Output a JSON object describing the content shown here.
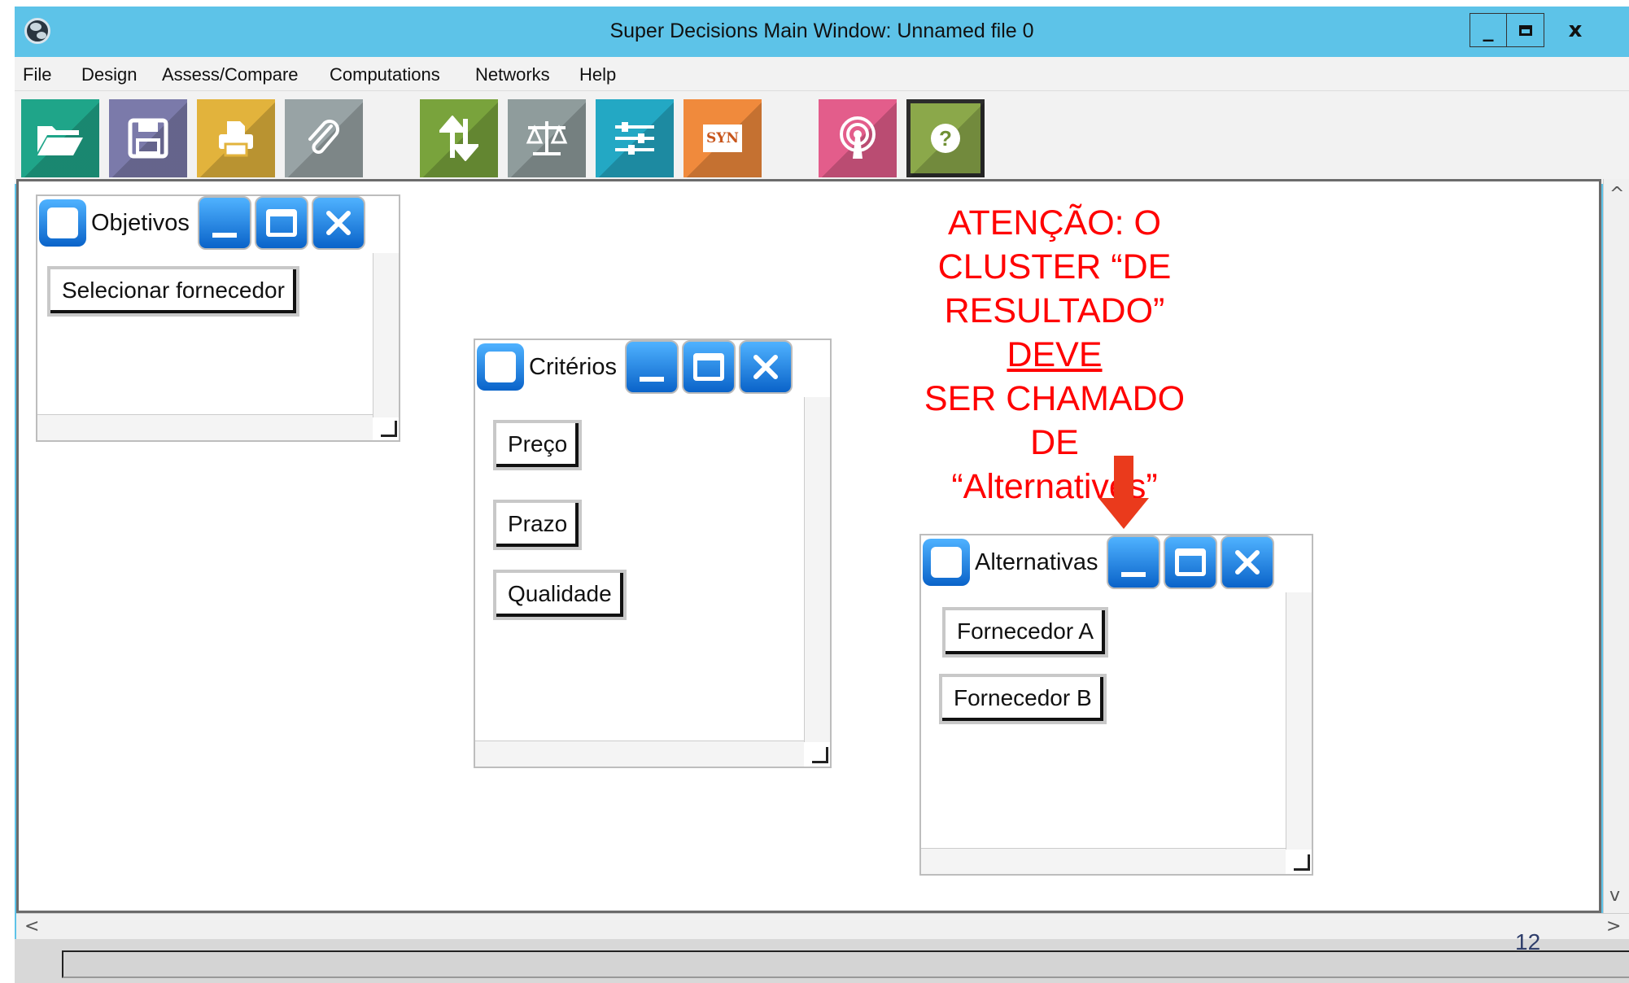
{
  "window": {
    "title": "Super Decisions Main Window: Unnamed file 0",
    "controls": {
      "minimize": "_",
      "close": "x"
    }
  },
  "menu": [
    "File",
    "Design",
    "Assess/Compare",
    "Computations",
    "Networks",
    "Help"
  ],
  "toolbar": {
    "buttons": [
      {
        "icon": "open-folder-icon",
        "color": "#1fa589"
      },
      {
        "icon": "save-icon",
        "color": "#7b7aaa"
      },
      {
        "icon": "print-icon",
        "color": "#e2b33c"
      },
      {
        "icon": "attach-icon",
        "color": "#98a3a5"
      },
      {
        "icon": "sync-icon",
        "color": "#79a33c"
      },
      {
        "icon": "balance-icon",
        "color": "#8f9c9c"
      },
      {
        "icon": "sliders-icon",
        "color": "#23a8c4"
      },
      {
        "icon": "syn-icon",
        "color": "#f08a3c",
        "label": "SYN"
      },
      {
        "icon": "broadcast-icon",
        "color": "#e35d8b"
      },
      {
        "icon": "help-icon",
        "color": "#8ba84a",
        "label": "?"
      }
    ]
  },
  "clusters": [
    {
      "title": "Objetivos",
      "nodes": [
        "Selecionar fornecedor"
      ]
    },
    {
      "title": "Critérios",
      "nodes": [
        "Preço",
        "Prazo",
        "Qualidade"
      ]
    },
    {
      "title": "Alternativas",
      "nodes": [
        "Fornecedor A",
        "Fornecedor B"
      ]
    }
  ],
  "annotation": {
    "line1": "ATENÇÃO: O",
    "line2": "CLUSTER “DE",
    "line3_pre": "RESULTADO” ",
    "line3_underlined": "DEVE",
    "line4": "SER CHAMADO DE",
    "line5": "“Alternatives”",
    "color": "#ff0000",
    "arrow_color": "#ea3a1c"
  },
  "scroll": {
    "up": "^",
    "down": "v",
    "left": "<",
    "right": ">"
  },
  "page_number": "12"
}
